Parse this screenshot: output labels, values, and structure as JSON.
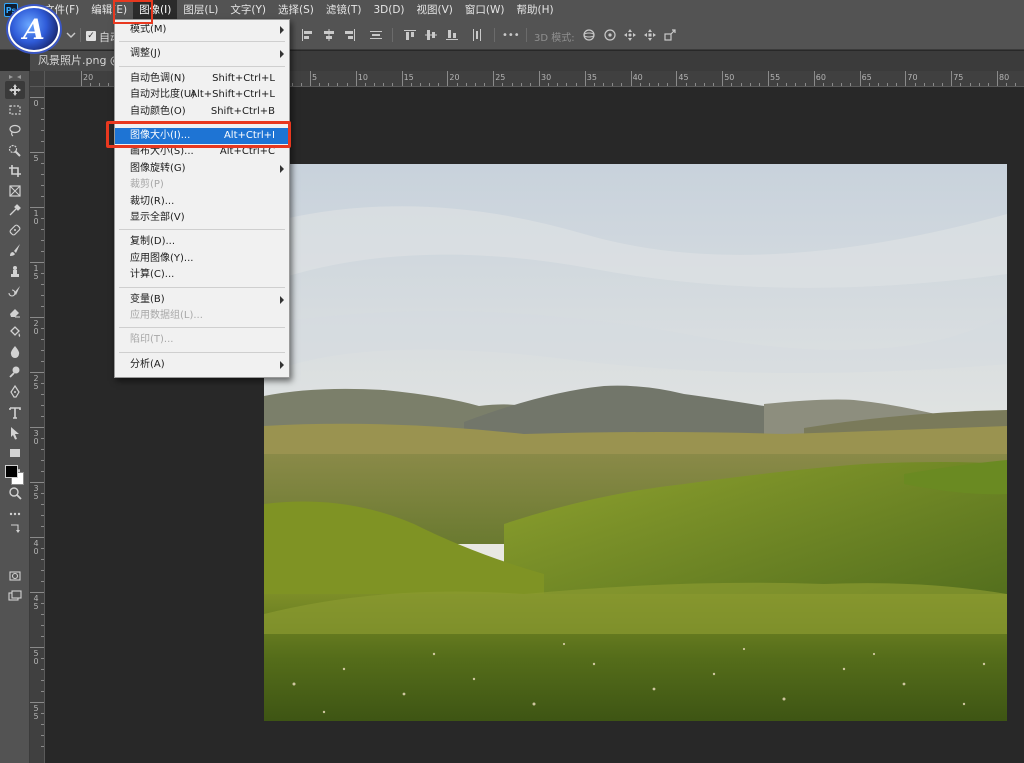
{
  "menubar": {
    "ps_logo": "Ps",
    "items": [
      {
        "label": "文件(F)"
      },
      {
        "label": "编辑(E)"
      },
      {
        "label": "图像(I)"
      },
      {
        "label": "图层(L)"
      },
      {
        "label": "文字(Y)"
      },
      {
        "label": "选择(S)"
      },
      {
        "label": "滤镜(T)"
      },
      {
        "label": "3D(D)"
      },
      {
        "label": "视图(V)"
      },
      {
        "label": "窗口(W)"
      },
      {
        "label": "帮助(H)"
      }
    ],
    "active_index": 2
  },
  "options_bar": {
    "auto_select_label": "自动",
    "checkbox_checked": true,
    "mode_3d_label": "3D 模式:",
    "more_label": "•••"
  },
  "document": {
    "tab_label": "风景照片.png @ "
  },
  "rulers": {
    "top_labels": [
      "20",
      "15",
      "10",
      "5",
      "0",
      "5",
      "10",
      "15",
      "20",
      "25",
      "30",
      "35",
      "40",
      "45",
      "50",
      "55",
      "60",
      "65",
      "70",
      "75",
      "80"
    ],
    "left_labels": [
      "0",
      "5",
      "1\n0",
      "1\n5",
      "2\n0",
      "2\n5",
      "3\n0",
      "3\n5",
      "4\n0",
      "4\n5",
      "5\n0",
      "5\n5"
    ]
  },
  "image_menu": {
    "items": [
      {
        "label": "模式(M)",
        "shortcut": "",
        "submenu": true,
        "disabled": false
      },
      {
        "sep": true
      },
      {
        "label": "调整(J)",
        "shortcut": "",
        "submenu": true,
        "disabled": false
      },
      {
        "sep": true
      },
      {
        "label": "自动色调(N)",
        "shortcut": "Shift+Ctrl+L",
        "submenu": false,
        "disabled": false
      },
      {
        "label": "自动对比度(U)",
        "shortcut": "Alt+Shift+Ctrl+L",
        "submenu": false,
        "disabled": false
      },
      {
        "label": "自动颜色(O)",
        "shortcut": "Shift+Ctrl+B",
        "submenu": false,
        "disabled": false
      },
      {
        "sep": true
      },
      {
        "label": "图像大小(I)...",
        "shortcut": "Alt+Ctrl+I",
        "submenu": false,
        "disabled": false,
        "highlighted": true
      },
      {
        "label": "画布大小(S)...",
        "shortcut": "Alt+Ctrl+C",
        "submenu": false,
        "disabled": false
      },
      {
        "label": "图像旋转(G)",
        "shortcut": "",
        "submenu": true,
        "disabled": false
      },
      {
        "label": "裁剪(P)",
        "shortcut": "",
        "submenu": false,
        "disabled": true
      },
      {
        "label": "裁切(R)...",
        "shortcut": "",
        "submenu": false,
        "disabled": false
      },
      {
        "label": "显示全部(V)",
        "shortcut": "",
        "submenu": false,
        "disabled": false
      },
      {
        "sep": true
      },
      {
        "label": "复制(D)...",
        "shortcut": "",
        "submenu": false,
        "disabled": false
      },
      {
        "label": "应用图像(Y)...",
        "shortcut": "",
        "submenu": false,
        "disabled": false
      },
      {
        "label": "计算(C)...",
        "shortcut": "",
        "submenu": false,
        "disabled": false
      },
      {
        "sep": true
      },
      {
        "label": "变量(B)",
        "shortcut": "",
        "submenu": true,
        "disabled": false
      },
      {
        "label": "应用数据组(L)...",
        "shortcut": "",
        "submenu": false,
        "disabled": true
      },
      {
        "sep": true
      },
      {
        "label": "陷印(T)...",
        "shortcut": "",
        "submenu": false,
        "disabled": true
      },
      {
        "sep": true
      },
      {
        "label": "分析(A)",
        "shortcut": "",
        "submenu": true,
        "disabled": false
      }
    ]
  },
  "tools": [
    {
      "icon": "move-tool-icon"
    },
    {
      "icon": "marquee-tool-icon"
    },
    {
      "icon": "lasso-tool-icon"
    },
    {
      "icon": "quick-select-tool-icon"
    },
    {
      "icon": "crop-tool-icon"
    },
    {
      "icon": "frame-tool-icon"
    },
    {
      "icon": "eyedropper-tool-icon"
    },
    {
      "icon": "healing-brush-tool-icon"
    },
    {
      "icon": "brush-tool-icon"
    },
    {
      "icon": "clone-stamp-tool-icon"
    },
    {
      "icon": "history-brush-tool-icon"
    },
    {
      "icon": "eraser-tool-icon"
    },
    {
      "icon": "paint-bucket-tool-icon"
    },
    {
      "icon": "blur-tool-icon"
    },
    {
      "icon": "dodge-tool-icon"
    },
    {
      "icon": "pen-tool-icon"
    },
    {
      "icon": "type-tool-icon"
    },
    {
      "icon": "path-select-tool-icon"
    },
    {
      "icon": "rectangle-tool-icon"
    },
    {
      "icon": "hand-tool-icon"
    },
    {
      "icon": "zoom-tool-icon"
    },
    {
      "icon": "more-tools-icon"
    }
  ],
  "colors": {
    "highlight_red": "#e8381f",
    "menu_selected": "#1e74d4",
    "foreground_color": "#000000",
    "background_color": "#ffffff"
  }
}
